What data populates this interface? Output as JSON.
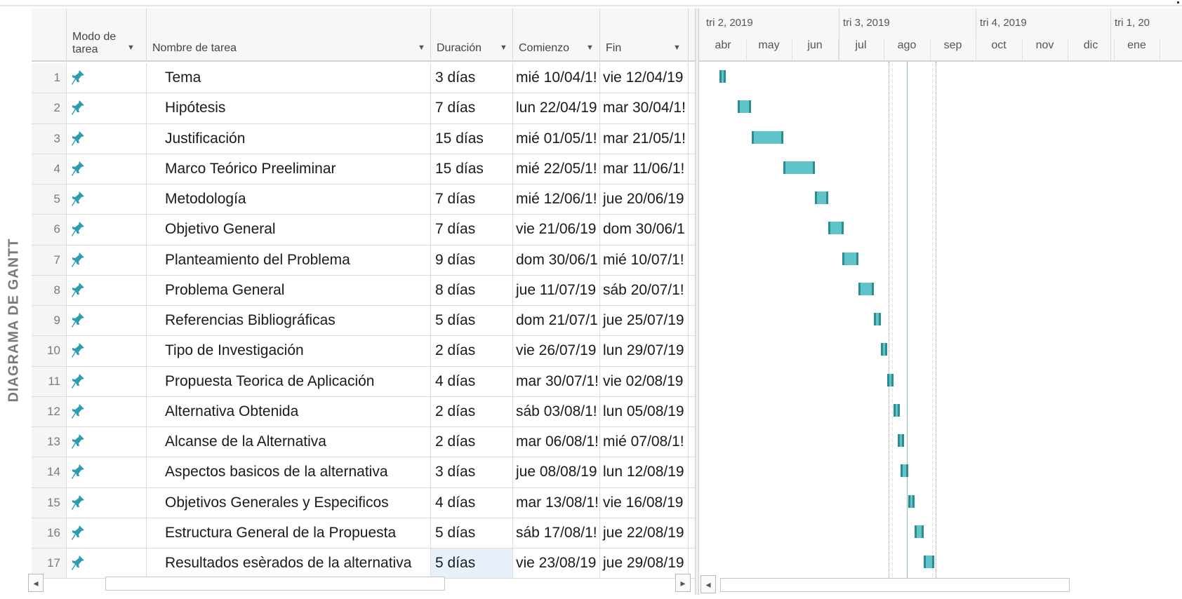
{
  "side_label": "DIAGRAMA DE GANTT",
  "columns": {
    "id": "",
    "mode_line1": "Modo de",
    "mode_line2": "tarea",
    "name": "Nombre de tarea",
    "duration": "Duración",
    "start": "Comienzo",
    "end": "Fin"
  },
  "timescale": {
    "quarters": [
      "tri 2, 2019",
      "tri 3, 2019",
      "tri 4, 2019",
      "tri 1, 20"
    ],
    "months": [
      "abr",
      "may",
      "jun",
      "jul",
      "ago",
      "sep",
      "oct",
      "nov",
      "dic",
      "ene"
    ]
  },
  "tasks": [
    {
      "id": "1",
      "name": "Tema",
      "duration": "3 días",
      "start": "mié 10/04/1!",
      "end": "vie 12/04/19"
    },
    {
      "id": "2",
      "name": "Hipótesis",
      "duration": "7 días",
      "start": "lun 22/04/19",
      "end": "mar 30/04/1!"
    },
    {
      "id": "3",
      "name": "Justificación",
      "duration": "15 días",
      "start": "mié 01/05/1!",
      "end": "mar 21/05/1!"
    },
    {
      "id": "4",
      "name": "Marco Teórico Preeliminar",
      "duration": "15 días",
      "start": "mié 22/05/1!",
      "end": "mar 11/06/1!"
    },
    {
      "id": "5",
      "name": "Metodología",
      "duration": "7 días",
      "start": "mié 12/06/1!",
      "end": "jue 20/06/19"
    },
    {
      "id": "6",
      "name": "Objetivo General",
      "duration": "7 días",
      "start": "vie 21/06/19",
      "end": "dom 30/06/1"
    },
    {
      "id": "7",
      "name": "Planteamiento del Problema",
      "duration": "9 días",
      "start": "dom 30/06/1",
      "end": "mié 10/07/1!"
    },
    {
      "id": "8",
      "name": "Problema General",
      "duration": "8 días",
      "start": "jue 11/07/19",
      "end": "sáb 20/07/1!"
    },
    {
      "id": "9",
      "name": "Referencias Bibliográficas",
      "duration": "5 días",
      "start": "dom 21/07/1",
      "end": "jue 25/07/19"
    },
    {
      "id": "10",
      "name": "Tipo de Investigación",
      "duration": "2 días",
      "start": "vie 26/07/19",
      "end": "lun 29/07/19"
    },
    {
      "id": "11",
      "name": "Propuesta Teorica de Aplicación",
      "duration": "4 días",
      "start": "mar 30/07/1!",
      "end": "vie 02/08/19"
    },
    {
      "id": "12",
      "name": "Alternativa Obtenida",
      "duration": "2 días",
      "start": "sáb 03/08/1!",
      "end": "lun 05/08/19"
    },
    {
      "id": "13",
      "name": "Alcanse de la Alternativa",
      "duration": "2 días",
      "start": "mar 06/08/1!",
      "end": "mié 07/08/1!"
    },
    {
      "id": "14",
      "name": "Aspectos basicos de la alternativa",
      "duration": "3 días",
      "start": "jue 08/08/19",
      "end": "lun 12/08/19"
    },
    {
      "id": "15",
      "name": "Objetivos Generales y Especificos",
      "duration": "4 días",
      "start": "mar 13/08/1!",
      "end": "vie 16/08/19"
    },
    {
      "id": "16",
      "name": "Estructura General de la Propuesta",
      "duration": "5 días",
      "start": "sáb 17/08/1!",
      "end": "jue 22/08/19"
    },
    {
      "id": "17",
      "name": "Resultados esèrados de la alternativa",
      "duration": "5 días",
      "start": "vie 23/08/19",
      "end": "jue 29/08/19"
    }
  ],
  "gantt_schedule": [
    {
      "start": "2019-04-10",
      "end": "2019-04-12"
    },
    {
      "start": "2019-04-22",
      "end": "2019-04-30"
    },
    {
      "start": "2019-05-01",
      "end": "2019-05-21"
    },
    {
      "start": "2019-05-22",
      "end": "2019-06-11"
    },
    {
      "start": "2019-06-12",
      "end": "2019-06-20"
    },
    {
      "start": "2019-06-21",
      "end": "2019-06-30"
    },
    {
      "start": "2019-06-30",
      "end": "2019-07-10"
    },
    {
      "start": "2019-07-11",
      "end": "2019-07-20"
    },
    {
      "start": "2019-07-21",
      "end": "2019-07-25"
    },
    {
      "start": "2019-07-26",
      "end": "2019-07-29"
    },
    {
      "start": "2019-07-30",
      "end": "2019-08-02"
    },
    {
      "start": "2019-08-03",
      "end": "2019-08-05"
    },
    {
      "start": "2019-08-06",
      "end": "2019-08-07"
    },
    {
      "start": "2019-08-08",
      "end": "2019-08-12"
    },
    {
      "start": "2019-08-13",
      "end": "2019-08-16"
    },
    {
      "start": "2019-08-17",
      "end": "2019-08-22"
    },
    {
      "start": "2019-08-23",
      "end": "2019-08-29"
    }
  ],
  "timeline_markers": [
    {
      "kind": "dotted",
      "date": "2019-07-31"
    },
    {
      "kind": "today",
      "date": "2019-08-12"
    },
    {
      "kind": "dotted",
      "date": "2019-08-31"
    }
  ],
  "scroll_left": "◂",
  "scroll_right": "▸",
  "colors": {
    "bar_fill": "#5fc4c9",
    "bar_edge": "#2b8c91",
    "pin": "#2d9cae",
    "today_line": "#8fc7a3"
  },
  "icons": {
    "task_mode": "pin-icon"
  }
}
